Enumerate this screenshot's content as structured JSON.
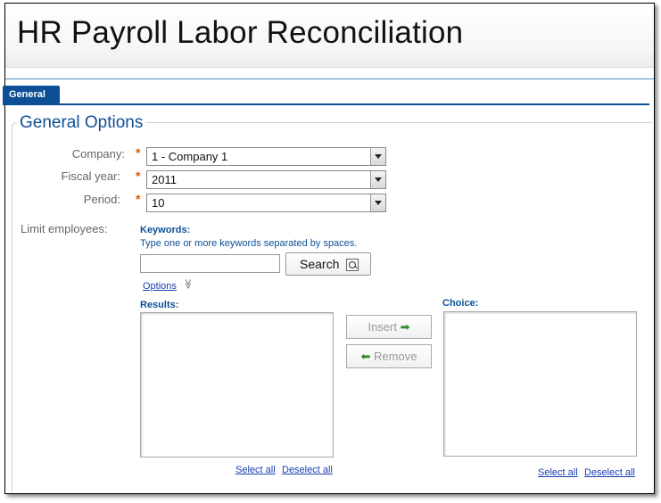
{
  "app": {
    "title": "HR Payroll Labor Reconciliation"
  },
  "tabs": [
    {
      "label": "General",
      "active": true
    }
  ],
  "section": {
    "legend": "General Options"
  },
  "fields": {
    "company": {
      "label": "Company:",
      "value": "1 - Company 1",
      "required": true
    },
    "fiscal_year": {
      "label": "Fiscal year:",
      "value": "2011",
      "required": true
    },
    "period": {
      "label": "Period:",
      "value": "10",
      "required": true
    }
  },
  "required_marker": "*",
  "limit_employees": {
    "label": "Limit employees:",
    "keywords_label": "Keywords:",
    "keywords_hint": "Type one or more keywords separated by spaces.",
    "keywords_value": "",
    "search_button": "Search",
    "options_link": "Options",
    "options_chevron": "≫",
    "results_label": "Results:",
    "choice_label": "Choice:",
    "insert_button": "Insert",
    "insert_arrow": "➡",
    "remove_button": "Remove",
    "remove_arrow": "⬅",
    "results_select_all": "Select all",
    "results_deselect_all": "Deselect all",
    "choice_select_all": "Select all",
    "choice_deselect_all": "Deselect all"
  },
  "colors": {
    "accent": "#0d4f95",
    "required": "#e05a00",
    "link": "#1a40b0",
    "arrow_green": "#2e8b2e"
  }
}
